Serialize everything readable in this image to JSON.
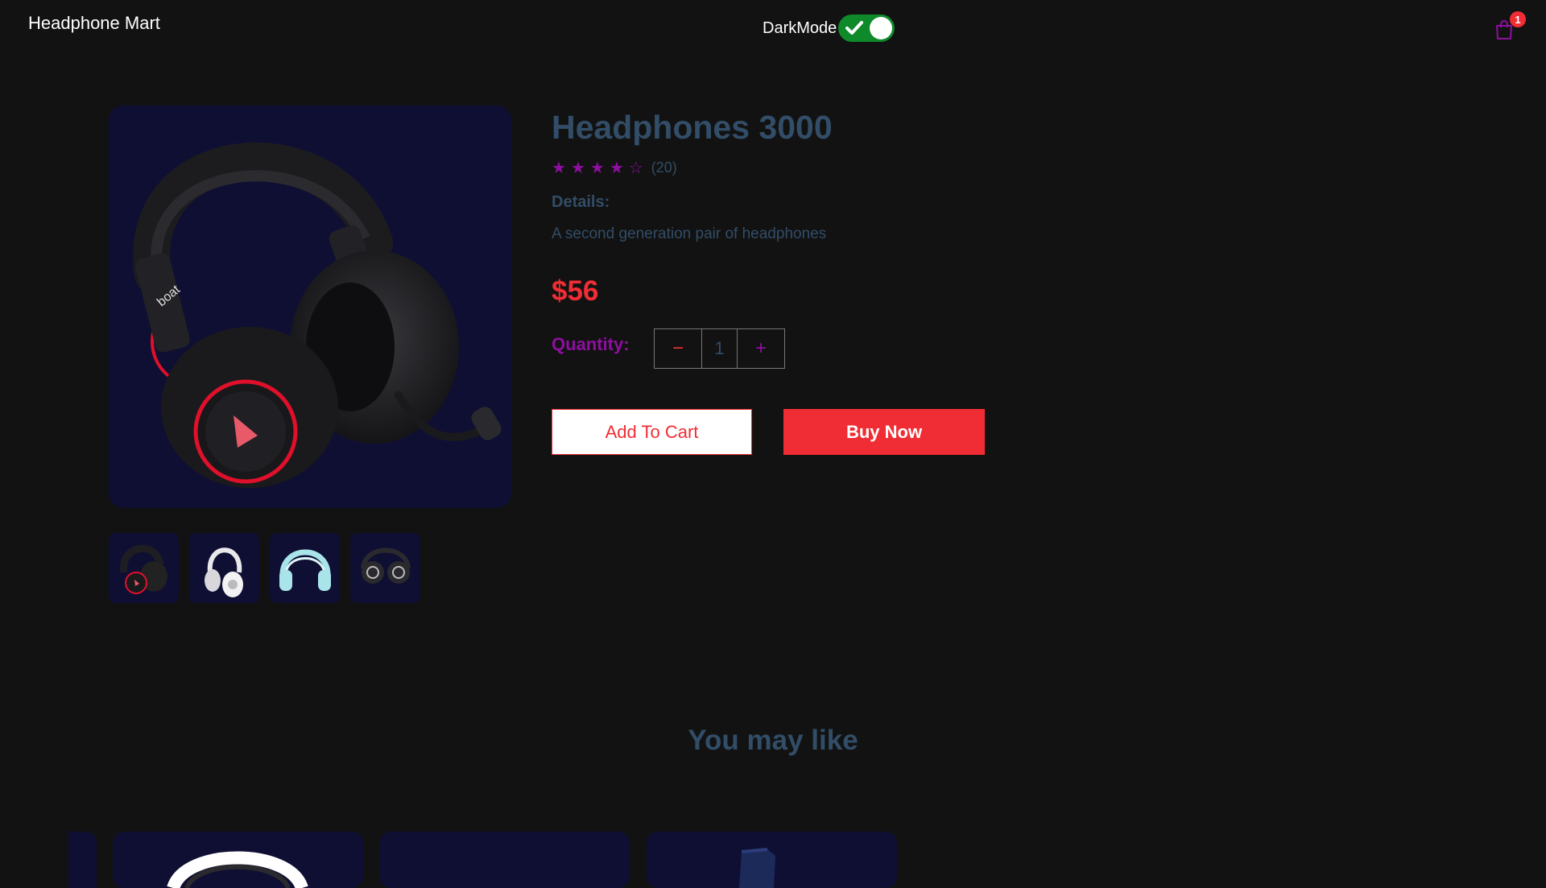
{
  "navbar": {
    "brand": "Headphone Mart",
    "dark_mode_label": "DarkMode",
    "dark_mode_on": true,
    "cart_count": "1"
  },
  "product": {
    "title": "Headphones 3000",
    "rating": 4,
    "rating_max": 5,
    "reviews": "(20)",
    "details_label": "Details:",
    "details_text": "A second generation pair of headphones",
    "price": "$56",
    "quantity_label": "Quantity:",
    "quantity": "1",
    "minus_symbol": "−",
    "plus_symbol": "+",
    "add_to_cart_label": "Add To Cart",
    "buy_now_label": "Buy Now",
    "thumbnails": [
      "black-red-headphones",
      "white-headphones",
      "mint-headphones",
      "dark-folded-headphones"
    ]
  },
  "recommendations": {
    "title": "You may like"
  },
  "colors": {
    "accent_red": "#f02d34",
    "accent_purple": "#8e0fa0",
    "text_slate": "#324d67",
    "card_navy": "#0f0f33",
    "background": "#121212",
    "toggle_green": "#0f8a2a"
  }
}
